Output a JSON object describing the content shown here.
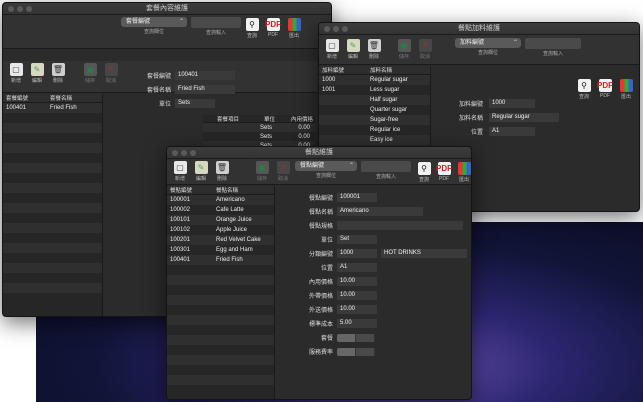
{
  "set_window": {
    "title": "套餐內容維護",
    "selector": "套餐編號",
    "selector_hint": "查詢欄位",
    "search_hint": "查詢輸入",
    "toolbar": {
      "new": "新增",
      "edit": "編輯",
      "delete": "刪除",
      "save": "儲存",
      "cancel": "取消",
      "find": "查詢",
      "pdf": "PDF",
      "export": "匯出"
    },
    "list_header": {
      "col1": "套餐編號",
      "col2": "套餐名稱"
    },
    "list_rows": [
      {
        "id": "100401",
        "name": "Fried Fish"
      }
    ],
    "form": {
      "id_label": "套餐編號",
      "id_value": "100401",
      "name_label": "套餐名稱",
      "name_value": "Fried Fish",
      "unit_label": "單位",
      "unit_value": "Sets"
    },
    "items_header": {
      "item": "套餐項目",
      "unit": "單位",
      "price": "內用價格"
    },
    "items": [
      {
        "unit": "Sets",
        "price": "0.00"
      },
      {
        "unit": "Sets",
        "price": "0.00"
      },
      {
        "unit": "Sets",
        "price": "0.00"
      }
    ]
  },
  "addon_window": {
    "title": "餐點加料維護",
    "selector": "加料編號",
    "selector_hint": "查詢欄位",
    "search_hint": "查詢輸入",
    "toolbar": {
      "new": "新增",
      "edit": "編輯",
      "delete": "刪除",
      "save": "儲存",
      "cancel": "取消",
      "find": "查詢",
      "pdf": "PDF",
      "export": "匯出"
    },
    "list_header": {
      "col1": "加料編號",
      "col2": "加料名稱"
    },
    "list_rows": [
      {
        "id": "1000",
        "name": "Regular sugar"
      },
      {
        "id": "1001",
        "name": "Less sugar"
      },
      {
        "id": "",
        "name": "Half sugar"
      },
      {
        "id": "",
        "name": "Quarter sugar"
      },
      {
        "id": "",
        "name": "Sugar-free"
      },
      {
        "id": "",
        "name": "Regular ice"
      },
      {
        "id": "",
        "name": "Easy ice"
      }
    ],
    "form": {
      "id_label": "加料編號",
      "id_value": "1000",
      "name_label": "加料名稱",
      "name_value": "Regular sugar",
      "pos_label": "位置",
      "pos_value": "A1"
    }
  },
  "meal_window": {
    "title": "餐點維護",
    "selector": "餐點編號",
    "selector_hint": "查詢欄位",
    "search_hint": "查詢輸入",
    "toolbar": {
      "new": "新增",
      "edit": "編輯",
      "delete": "刪除",
      "save": "儲存",
      "cancel": "取消",
      "find": "查詢",
      "pdf": "PDF",
      "export": "匯出"
    },
    "list_header": {
      "col1": "餐點編號",
      "col2": "餐點名稱"
    },
    "list_rows": [
      {
        "id": "100001",
        "name": "Americano"
      },
      {
        "id": "100002",
        "name": "Cafe Latte"
      },
      {
        "id": "100101",
        "name": "Orange Juice"
      },
      {
        "id": "100102",
        "name": "Apple Juice"
      },
      {
        "id": "100201",
        "name": "Red Velvet Cake"
      },
      {
        "id": "100301",
        "name": "Egg and Ham"
      },
      {
        "id": "100401",
        "name": "Fried Fish"
      }
    ],
    "behind_ids": [
      "100101",
      "100102",
      "100101"
    ],
    "form": {
      "id_label": "餐點編號",
      "id_value": "100001",
      "name_label": "餐點名稱",
      "name_value": "Americano",
      "spec_label": "餐點規格",
      "spec_value": "",
      "unit_label": "單位",
      "unit_value": "Set",
      "cat_label": "分類編號",
      "cat_value": "1000",
      "cat_name": "HOT DRINKS",
      "pos_label": "位置",
      "pos_value": "A1",
      "dinein_label": "內用價格",
      "dinein_value": "10.00",
      "takeout_label": "外帶價格",
      "takeout_value": "10.00",
      "delivery_label": "外送價格",
      "delivery_value": "10.00",
      "cost_label": "標準成本",
      "cost_value": "5.00",
      "set_label": "套餐",
      "service_label": "服務費率"
    }
  }
}
